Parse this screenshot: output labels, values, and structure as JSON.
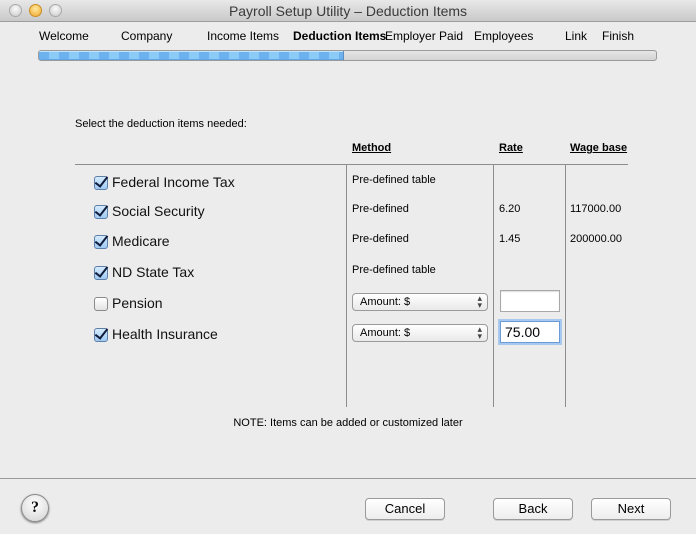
{
  "window": {
    "title": "Payroll Setup Utility – Deduction Items"
  },
  "steps": [
    {
      "label": "Welcome",
      "active": false
    },
    {
      "label": "Company",
      "active": false
    },
    {
      "label": "Income Items",
      "active": false
    },
    {
      "label": "Deduction Items",
      "active": true
    },
    {
      "label": "Employer Paid",
      "active": false
    },
    {
      "label": "Employees",
      "active": false
    },
    {
      "label": "Link",
      "active": false
    },
    {
      "label": "Finish",
      "active": false
    }
  ],
  "progress": {
    "percent": 49.5
  },
  "instruction": "Select the deduction items needed:",
  "table": {
    "headers": {
      "method": "Method",
      "rate": "Rate",
      "wage_base": "Wage base"
    },
    "rows": [
      {
        "name": "Federal Income Tax",
        "checked": true,
        "method": "Pre-defined table",
        "method_type": "text",
        "rate": "",
        "wage_base": ""
      },
      {
        "name": "Social Security",
        "checked": true,
        "method": "Pre-defined",
        "method_type": "text",
        "rate": "6.20",
        "wage_base": "117000.00"
      },
      {
        "name": "Medicare",
        "checked": true,
        "method": "Pre-defined",
        "method_type": "text",
        "rate": "1.45",
        "wage_base": "200000.00"
      },
      {
        "name": "ND State Tax",
        "checked": true,
        "method": "Pre-defined table",
        "method_type": "text",
        "rate": "",
        "wage_base": ""
      },
      {
        "name": "Pension",
        "checked": false,
        "method": "Amount: $",
        "method_type": "select",
        "rate": "",
        "rate_type": "input",
        "wage_base": ""
      },
      {
        "name": "Health Insurance",
        "checked": true,
        "method": "Amount: $",
        "method_type": "select",
        "rate": "75.00",
        "rate_type": "input",
        "rate_focused": true,
        "wage_base": ""
      }
    ]
  },
  "note": "NOTE:  Items can be added or customized later",
  "buttons": {
    "help": "?",
    "cancel": "Cancel",
    "back": "Back",
    "next": "Next"
  },
  "icons": {
    "select_arrows": "↕"
  }
}
